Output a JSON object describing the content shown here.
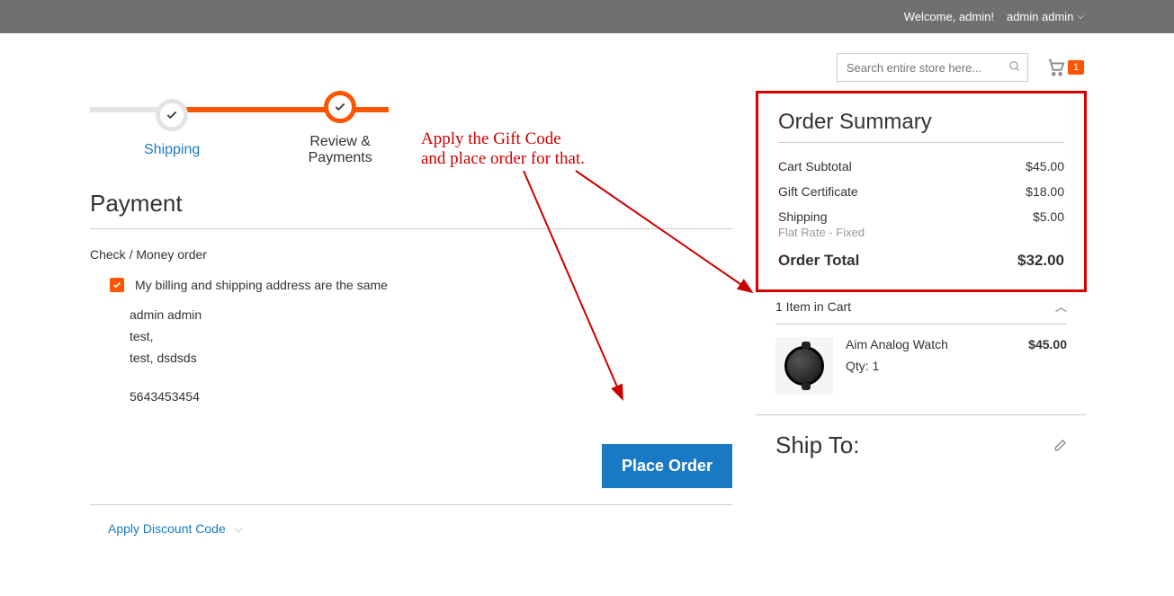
{
  "topbar": {
    "welcome": "Welcome, admin!",
    "user_name": "admin admin"
  },
  "header": {
    "search_placeholder": "Search entire store here...",
    "cart_count": "1"
  },
  "progress": {
    "step1": "Shipping",
    "step2": "Review & Payments"
  },
  "payment": {
    "title": "Payment",
    "method": "Check / Money order",
    "same_address_label": "My billing and shipping address are the same",
    "address": {
      "name": "admin admin",
      "line1": "test,",
      "line2": "test, dsdsds",
      "phone": "5643453454"
    },
    "place_order": "Place Order",
    "discount_label": "Apply Discount Code"
  },
  "summary": {
    "title": "Order Summary",
    "rows": [
      {
        "label": "Cart Subtotal",
        "value": "$45.00"
      },
      {
        "label": "Gift Certificate",
        "value": "$18.00"
      },
      {
        "label": "Shipping",
        "value": "$5.00",
        "desc": "Flat Rate - Fixed"
      }
    ],
    "total_label": "Order Total",
    "total_value": "$32.00"
  },
  "cart": {
    "header": "1 Item in Cart",
    "items": [
      {
        "name": "Aim Analog Watch",
        "qty": "Qty: 1",
        "price": "$45.00"
      }
    ]
  },
  "shipto": {
    "title": "Ship To:"
  },
  "annotation": {
    "line1": "Apply the Gift Code",
    "line2": "and place order for that."
  }
}
